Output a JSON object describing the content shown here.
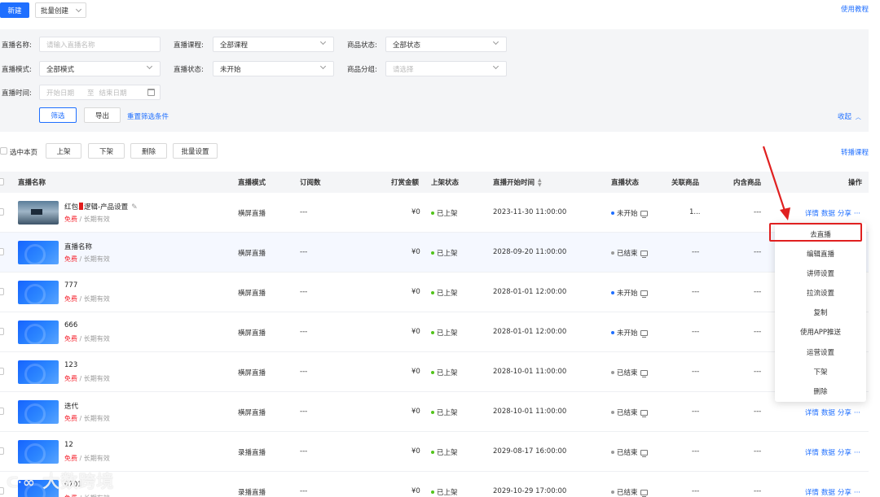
{
  "topbar": {
    "new_label": "新建",
    "batch_create_label": "批量创建",
    "tutorial_label": "使用教程"
  },
  "filters": {
    "live_name_label": "直播名称:",
    "live_name_placeholder": "请输入直播名称",
    "live_course_label": "直播课程:",
    "live_course_value": "全部课程",
    "product_status_label": "商品状态:",
    "product_status_value": "全部状态",
    "live_mode_label": "直播模式:",
    "live_mode_value": "全部模式",
    "live_status_label": "直播状态:",
    "live_status_value": "未开始",
    "product_group_label": "商品分组:",
    "product_group_placeholder": "请选择",
    "live_time_label": "直播时间:",
    "start_date_placeholder": "开始日期",
    "date_separator": "至",
    "end_date_placeholder": "结束日期",
    "filter_button": "筛选",
    "export_button": "导出",
    "reset_link": "重置筛选条件",
    "collapse_link": "收起"
  },
  "toolbar": {
    "select_page_label": "选中本页",
    "on_shelf_label": "上架",
    "off_shelf_label": "下架",
    "delete_label": "删除",
    "batch_settings_label": "批量设置",
    "transfer_course_label": "转播课程"
  },
  "table": {
    "headers": {
      "name": "直播名称",
      "mode": "直播模式",
      "subs": "订阅数",
      "tips": "打赏金额",
      "shelf": "上架状态",
      "start": "直播开始时间",
      "status": "直播状态",
      "related": "关联商品",
      "inner": "内含商品",
      "ops": "操作"
    },
    "price_free": "免费",
    "price_sep": " / ",
    "price_validity": "长期有效",
    "action_detail": "详情",
    "action_data": "数据",
    "action_share": "分享",
    "action_more": "···",
    "rows": [
      {
        "name_a": "红包",
        "name_b": "逻辑-产品设置",
        "mode": "横屏直播",
        "subs": "---",
        "tips": "¥0",
        "shelf": "已上架",
        "start": "2023-11-30 11:00:00",
        "status": "未开始",
        "related": "1...",
        "inner": "---"
      },
      {
        "name": "直播名称",
        "mode": "横屏直播",
        "subs": "---",
        "tips": "¥0",
        "shelf": "已上架",
        "start": "2028-09-20 11:00:00",
        "status": "已结束",
        "related": "---",
        "inner": "---"
      },
      {
        "name": "777",
        "mode": "横屏直播",
        "subs": "---",
        "tips": "¥0",
        "shelf": "已上架",
        "start": "2028-01-01 12:00:00",
        "status": "未开始",
        "related": "---",
        "inner": "---"
      },
      {
        "name": "666",
        "mode": "横屏直播",
        "subs": "---",
        "tips": "¥0",
        "shelf": "已上架",
        "start": "2028-01-01 12:00:00",
        "status": "未开始",
        "related": "---",
        "inner": "---"
      },
      {
        "name": "123",
        "mode": "横屏直播",
        "subs": "---",
        "tips": "¥0",
        "shelf": "已上架",
        "start": "2028-10-01 11:00:00",
        "status": "已结束",
        "related": "---",
        "inner": "---"
      },
      {
        "name": "迭代",
        "mode": "横屏直播",
        "subs": "---",
        "tips": "¥0",
        "shelf": "已上架",
        "start": "2028-10-01 11:00:00",
        "status": "已结束",
        "related": "---",
        "inner": "---"
      },
      {
        "name": "12",
        "mode": "录播直播",
        "subs": "---",
        "tips": "¥0",
        "shelf": "已上架",
        "start": "2029-08-17 16:00:00",
        "status": "已结束",
        "related": "---",
        "inner": "---"
      },
      {
        "name": "0701",
        "mode": "录播直播",
        "subs": "---",
        "tips": "¥0",
        "shelf": "已上架",
        "start": "2029-10-29 17:00:00",
        "status": "已结束",
        "related": "---",
        "inner": "---"
      }
    ]
  },
  "dropdown": {
    "items": [
      "去直播",
      "编辑直播",
      "讲师设置",
      "拉流设置",
      "复制",
      "使用APP推送",
      "运营设置",
      "下架",
      "删除"
    ]
  },
  "watermark": "大数跨境",
  "colors": {
    "primary": "#1f6fff",
    "annotation_red": "#e02020",
    "free_red": "#f5222d",
    "status_green": "#52c41a",
    "status_blue": "#1f6fff",
    "status_grey": "#999999"
  }
}
